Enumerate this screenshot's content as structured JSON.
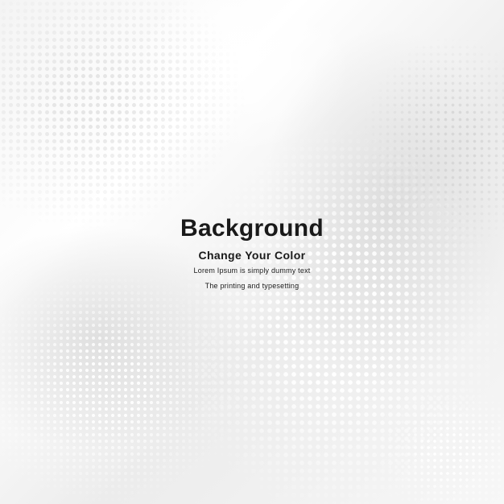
{
  "background": {
    "base_color": "#f2f2f2",
    "dot_color": "#ffffff",
    "shade_color": "#d2d2d2"
  },
  "text": {
    "title": "Background",
    "subtitle": "Change Your Color",
    "line1": "Lorem Ipsum is simply dummy text",
    "line2": "The printing and typesetting",
    "text_color": "#1a1a1a"
  }
}
